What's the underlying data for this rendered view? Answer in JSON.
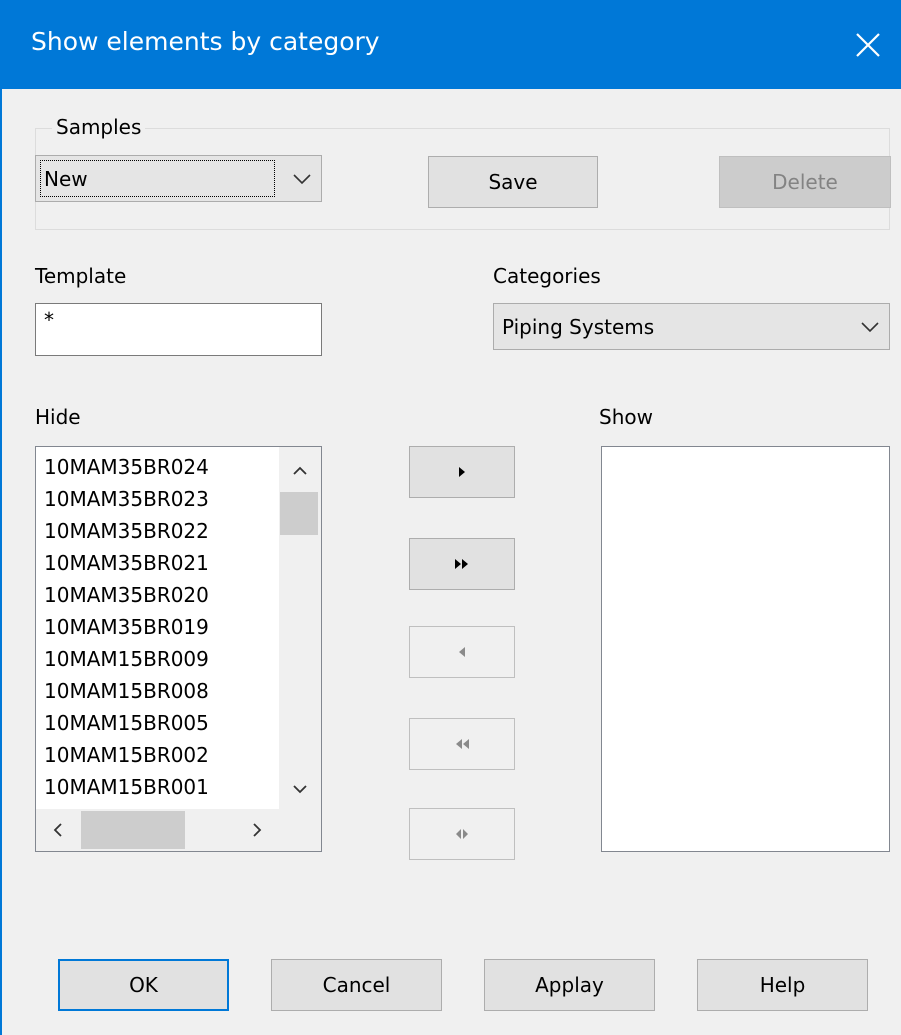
{
  "window": {
    "title": "Show elements by category"
  },
  "samples": {
    "group_label": "Samples",
    "selected": "New",
    "save_label": "Save",
    "delete_label": "Delete"
  },
  "template": {
    "label": "Template",
    "value": "*"
  },
  "categories": {
    "label": "Categories",
    "selected": "Piping Systems"
  },
  "hide": {
    "label": "Hide",
    "items": [
      "10MAM35BR024",
      "10MAM35BR023",
      "10MAM35BR022",
      "10MAM35BR021",
      "10MAM35BR020",
      "10MAM35BR019",
      "10MAM15BR009",
      "10MAM15BR008",
      "10MAM15BR005",
      "10MAM15BR002",
      "10MAM15BR001"
    ]
  },
  "show": {
    "label": "Show",
    "items": []
  },
  "transfer_buttons": [
    {
      "name": "move-selected-right-button",
      "icon": "arrow-right-icon",
      "enabled": true
    },
    {
      "name": "move-all-right-button",
      "icon": "double-arrow-right-icon",
      "enabled": true
    },
    {
      "name": "move-selected-left-button",
      "icon": "arrow-left-icon",
      "enabled": false
    },
    {
      "name": "move-all-left-button",
      "icon": "double-arrow-left-icon",
      "enabled": false
    },
    {
      "name": "swap-button",
      "icon": "swap-icon",
      "enabled": false
    }
  ],
  "footer": {
    "ok_label": "OK",
    "cancel_label": "Cancel",
    "apply_label": "Applay",
    "help_label": "Help"
  },
  "colors": {
    "titlebar": "#0078d7",
    "window_bg": "#f0f0f0"
  }
}
